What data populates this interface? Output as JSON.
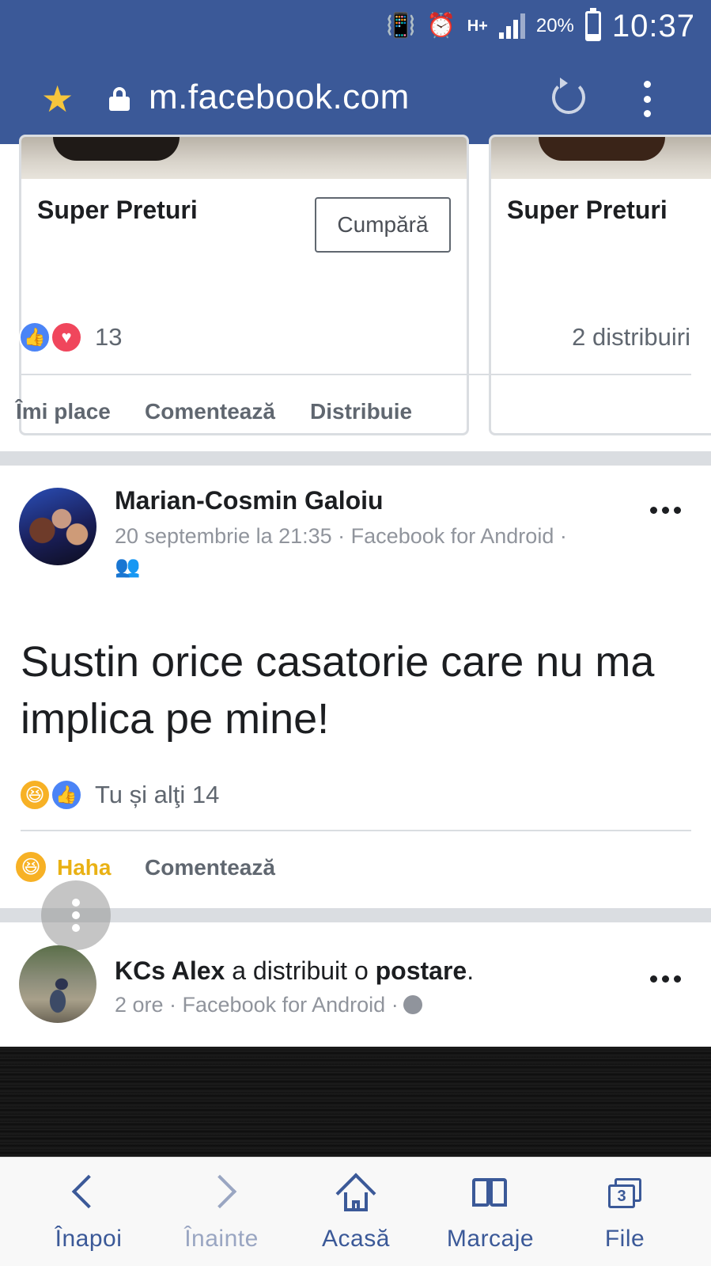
{
  "status_bar": {
    "network": "H+",
    "battery_percent": "20%",
    "battery_level": 0.2,
    "time": "10:37"
  },
  "browser": {
    "url": "m.facebook.com",
    "icons": [
      "star-icon",
      "lock-icon",
      "reload-icon",
      "menu-icon"
    ]
  },
  "ad_cards": [
    {
      "title": "Super Preturi",
      "button": "Cumpără"
    },
    {
      "title": "Super Preturi"
    }
  ],
  "ad_post": {
    "reaction_count": "13",
    "shares": "2 distribuiri",
    "actions": {
      "like": "Îmi place",
      "comment": "Comentează",
      "share": "Distribuie"
    }
  },
  "post1": {
    "author": "Marian-Cosmin Galoiu",
    "meta": "20 septembrie la 21:35 · Facebook for Android ·",
    "audience_icon": "friends-icon",
    "text": "Sustin orice casatorie care nu ma implica pe mine!",
    "reactions_summary": "Tu și alţi 14",
    "actions": {
      "reaction": "Haha",
      "comment": "Comentează"
    }
  },
  "post2": {
    "author": "KCs Alex",
    "shared_text": "a distribuit o",
    "shared_object": "postare",
    "meta": "2 ore · Facebook for Android ·",
    "audience_icon": "globe-icon"
  },
  "bottom_nav": {
    "back": "Înapoi",
    "forward": "Înainte",
    "home": "Acasă",
    "bookmarks": "Marcaje",
    "tabs": "File",
    "tabs_count": "3"
  },
  "colors": {
    "brand": "#3b5998",
    "like": "#4b84f6",
    "love": "#f0465c",
    "haha": "#f7b125",
    "muted": "#606770"
  }
}
